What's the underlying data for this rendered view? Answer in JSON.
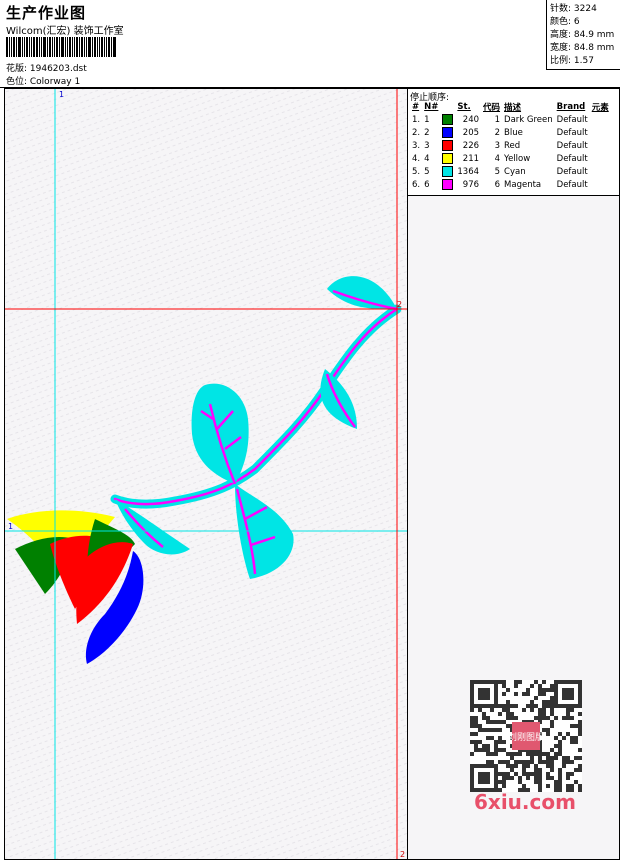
{
  "header": {
    "title": "生产作业图",
    "company": "Wilcom(汇宏) 装饰工作室",
    "design_label": "花版: 1946203.dst",
    "colorway_label": "色位: Colorway 1"
  },
  "stats": [
    "针数: 3224",
    "颜色: 6",
    "高度: 84.9 mm",
    "宽度: 84.8 mm",
    "比例: 1.57"
  ],
  "stop_sequence": {
    "title": "停止顺序:",
    "columns": [
      "#",
      "N#",
      "St.",
      "代码",
      "描述",
      "Brand",
      "元素"
    ],
    "rows": [
      {
        "idx": "1.",
        "n": "1",
        "color": "#008000",
        "st": "240",
        "code": "1",
        "desc": "Dark Green",
        "brand": "Default"
      },
      {
        "idx": "2.",
        "n": "2",
        "color": "#0000ff",
        "st": "205",
        "code": "2",
        "desc": "Blue",
        "brand": "Default"
      },
      {
        "idx": "3.",
        "n": "3",
        "color": "#ff0000",
        "st": "226",
        "code": "3",
        "desc": "Red",
        "brand": "Default"
      },
      {
        "idx": "4.",
        "n": "4",
        "color": "#ffff00",
        "st": "211",
        "code": "4",
        "desc": "Yellow",
        "brand": "Default"
      },
      {
        "idx": "5.",
        "n": "5",
        "color": "#00e5e5",
        "st": "1364",
        "code": "5",
        "desc": "Cyan",
        "brand": "Default"
      },
      {
        "idx": "6.",
        "n": "6",
        "color": "#ff00ff",
        "st": "976",
        "code": "6",
        "desc": "Magenta",
        "brand": "Default"
      }
    ]
  },
  "guides": {
    "vertical_top_label": "1",
    "vertical_bottom_label": "2",
    "horizontal_left_label": "1",
    "horizontal_right_label": "2"
  },
  "watermark": "6xiu.com",
  "qr_stamp": "刘刚图版"
}
